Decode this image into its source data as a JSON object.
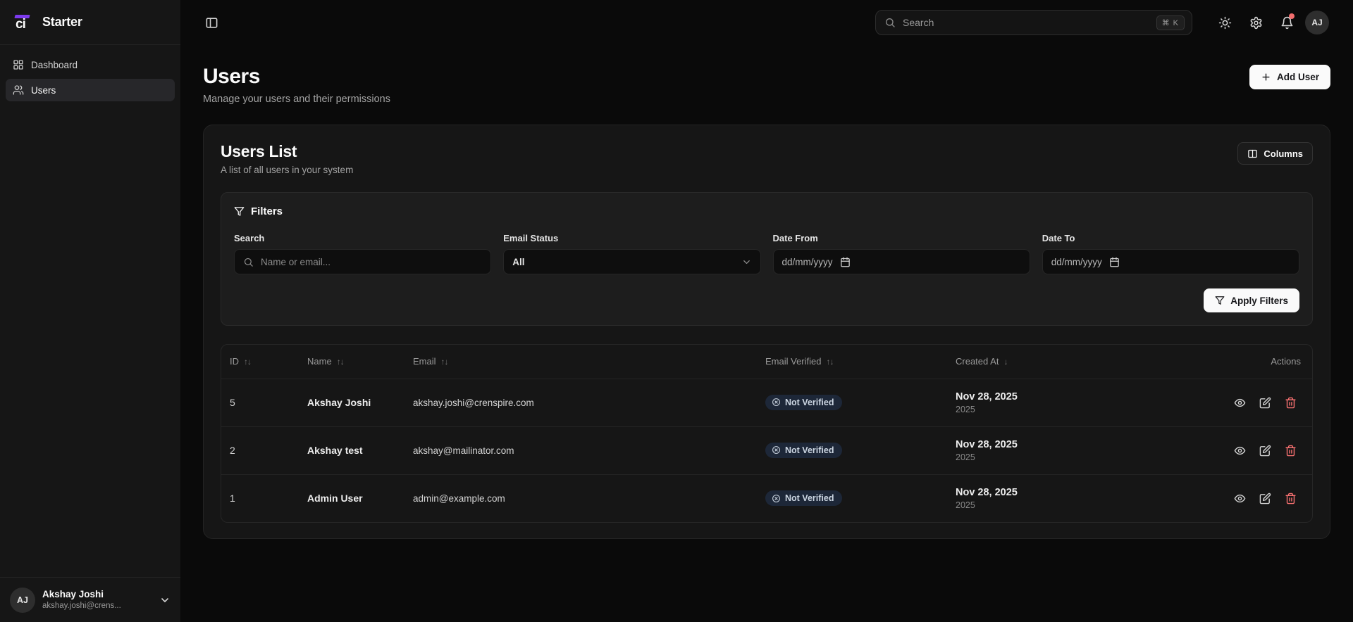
{
  "brand": {
    "logo_text": "ci",
    "name": "Starter"
  },
  "topbar": {
    "search_placeholder": "Search",
    "shortcut": "⌘ K",
    "avatar_initials": "AJ"
  },
  "sidebar": {
    "items": [
      {
        "label": "Dashboard",
        "active": false
      },
      {
        "label": "Users",
        "active": true
      }
    ],
    "profile": {
      "initials": "AJ",
      "name": "Akshay Joshi",
      "email": "akshay.joshi@crens..."
    }
  },
  "page": {
    "title": "Users",
    "subtitle": "Manage your users and their permissions",
    "add_user_label": "Add User"
  },
  "card": {
    "title": "Users List",
    "subtitle": "A list of all users in your system",
    "columns_label": "Columns"
  },
  "filters": {
    "title": "Filters",
    "search_label": "Search",
    "search_placeholder": "Name or email...",
    "email_status_label": "Email Status",
    "email_status_value": "All",
    "date_from_label": "Date From",
    "date_to_label": "Date To",
    "date_placeholder": "dd/mm/yyyy",
    "apply_label": "Apply Filters"
  },
  "table": {
    "columns": [
      {
        "label": "ID",
        "sort_glyph": "↑↓"
      },
      {
        "label": "Name",
        "sort_glyph": "↑↓"
      },
      {
        "label": "Email",
        "sort_glyph": "↑↓"
      },
      {
        "label": "Email Verified",
        "sort_glyph": "↑↓"
      },
      {
        "label": "Created At",
        "sort_glyph": "↓"
      },
      {
        "label": "Actions",
        "sort_glyph": ""
      }
    ],
    "rows": [
      {
        "id": "5",
        "name": "Akshay Joshi",
        "email": "akshay.joshi@crenspire.com",
        "verified": "Not Verified",
        "created": "Nov 28, 2025",
        "created_sub": "2025"
      },
      {
        "id": "2",
        "name": "Akshay test",
        "email": "akshay@mailinator.com",
        "verified": "Not Verified",
        "created": "Nov 28, 2025",
        "created_sub": "2025"
      },
      {
        "id": "1",
        "name": "Admin User",
        "email": "admin@example.com",
        "verified": "Not Verified",
        "created": "Nov 28, 2025",
        "created_sub": "2025"
      }
    ]
  },
  "colors": {
    "background": "#0a0a0a",
    "surface": "#161616",
    "accent_purple": "#7c3aed",
    "primary_button": "#fafafa",
    "danger": "#f87171",
    "notification_dot": "#f26d6d",
    "badge_background": "#1d2738",
    "badge_text": "#cbd5e1"
  }
}
